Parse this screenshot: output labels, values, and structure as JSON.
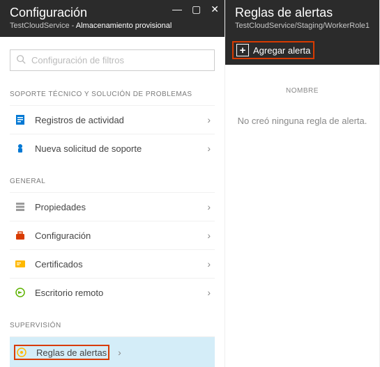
{
  "left": {
    "title": "Configuración",
    "service_prefix": "TestCloudService - ",
    "service_suffix": "Almacenamiento provisional",
    "search_placeholder": "Configuración de filtros",
    "sections": {
      "support": {
        "label": "SOPORTE TÉCNICO Y SOLUCIÓN DE PROBLEMAS",
        "items": {
          "activity": "Registros de actividad",
          "support_request": "Nueva solicitud de soporte"
        }
      },
      "general": {
        "label": "GENERAL",
        "items": {
          "properties": "Propiedades",
          "configuration": "Configuración",
          "certificates": "Certificados",
          "remote_desktop": "Escritorio remoto"
        }
      },
      "monitoring": {
        "label": "SUPERVISIÓN",
        "items": {
          "alert_rules": "Reglas de alertas"
        }
      }
    }
  },
  "right": {
    "title": "Reglas de alertas",
    "breadcrumb": "TestCloudService/Staging/WorkerRole1",
    "add_label": "Agregar alerta",
    "column_header": "NOMBRE",
    "empty": "No creó ninguna regla de alerta."
  }
}
